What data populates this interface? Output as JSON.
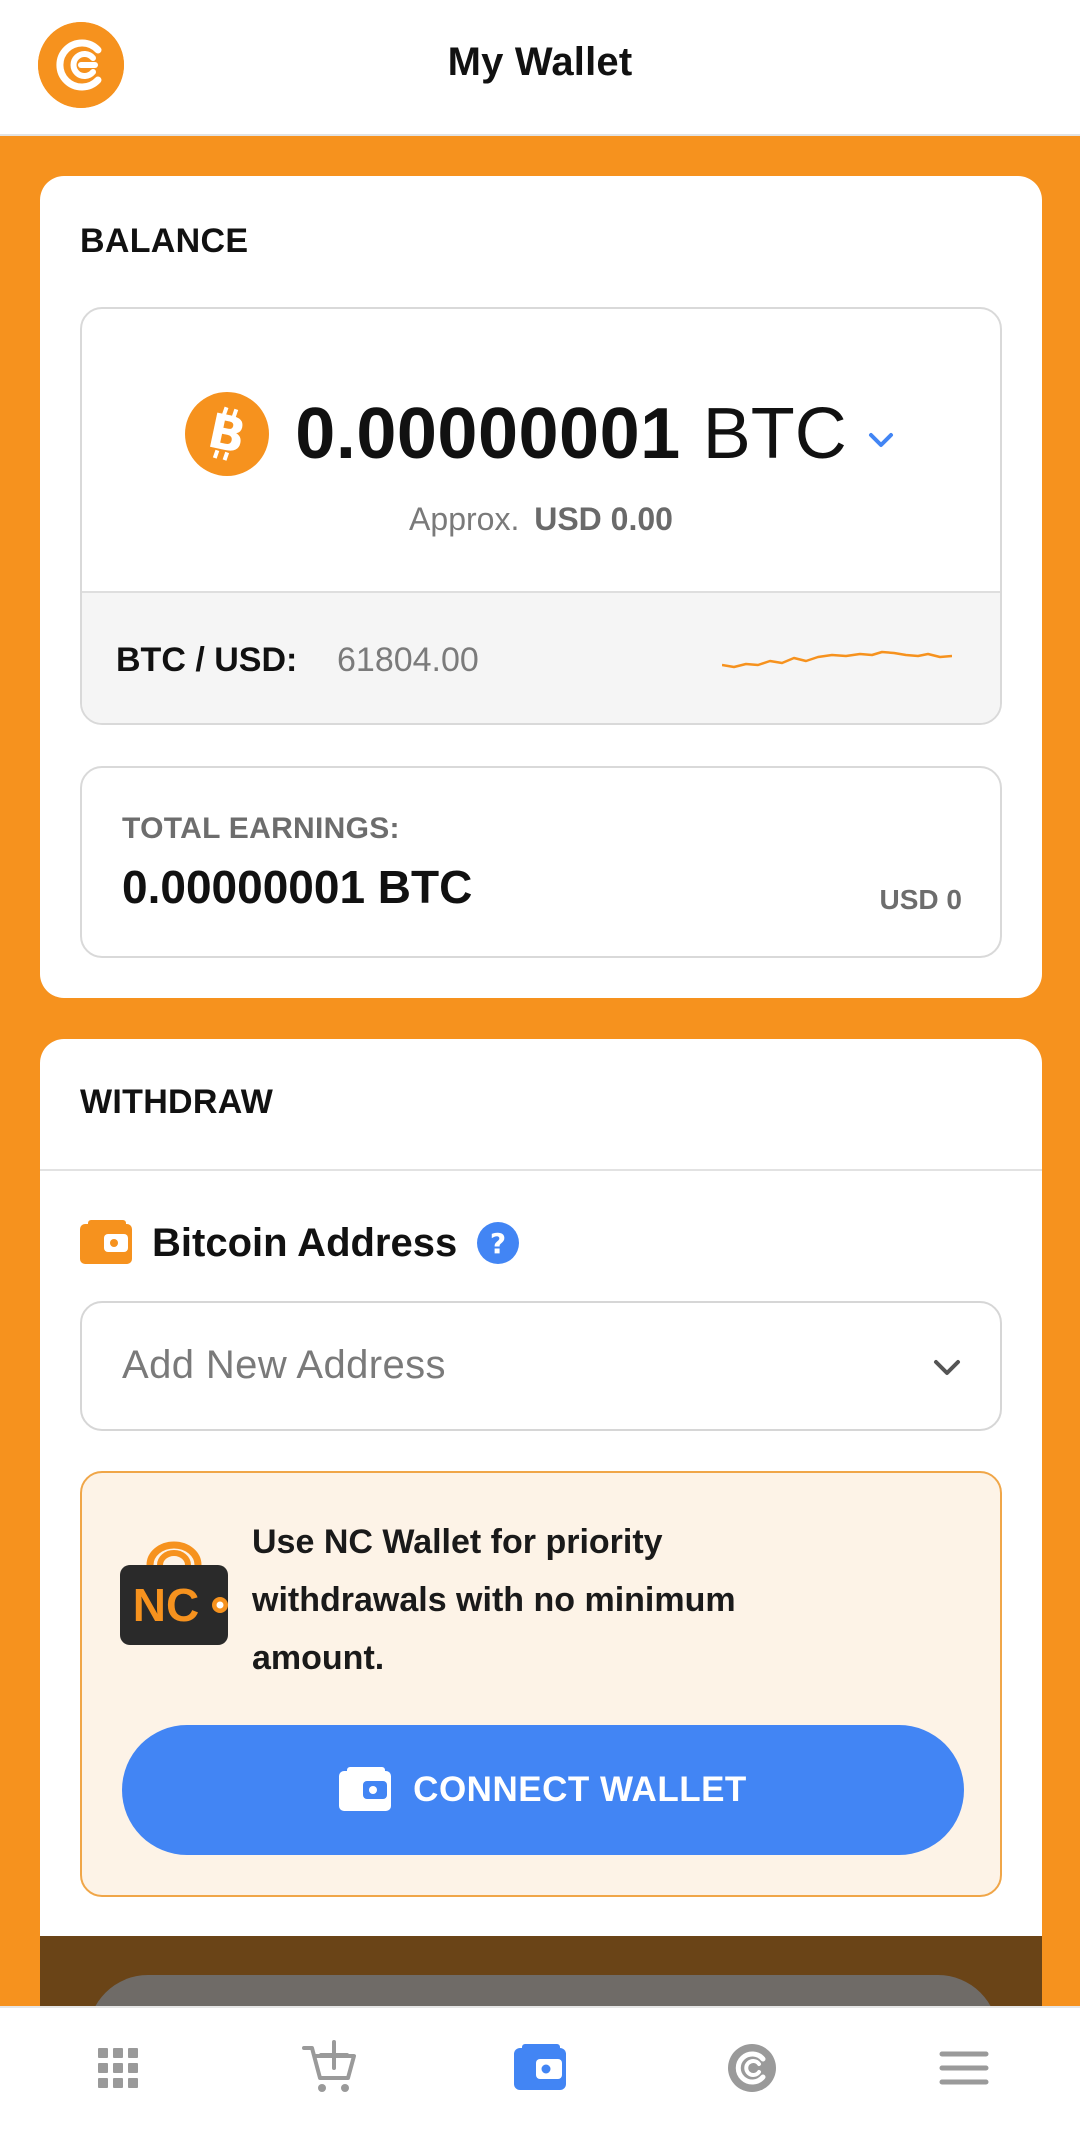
{
  "header": {
    "title": "My Wallet",
    "logo_icon": "coin-logo-icon"
  },
  "balance": {
    "section_label": "BALANCE",
    "amount": "0.00000001",
    "unit": "BTC",
    "approx_prefix": "Approx.",
    "approx_value": "USD 0.00",
    "rate_label": "BTC / USD:",
    "rate_value": "61804.00",
    "sparkline_color": "#f6921e"
  },
  "earnings": {
    "label": "TOTAL EARNINGS:",
    "amount": "0.00000001 BTC",
    "usd": "USD 0"
  },
  "withdraw": {
    "section_label": "WITHDRAW",
    "address_title": "Bitcoin Address",
    "address_placeholder": "Add New Address",
    "promo_text": "Use NC Wallet for priority withdrawals with no minimum amount.",
    "nc_logo_text": "NC",
    "connect_label": "CONNECT WALLET"
  },
  "bottom_nav": [
    {
      "name": "grid-icon",
      "active": false
    },
    {
      "name": "cart-add-icon",
      "active": false
    },
    {
      "name": "wallet-icon",
      "active": true
    },
    {
      "name": "coin-icon",
      "active": false
    },
    {
      "name": "menu-icon",
      "active": false
    }
  ],
  "colors": {
    "accent": "#f6921e",
    "primary_blue": "#4285f4",
    "nav_inactive": "#9a9a9a",
    "promo_bg": "#fdf3e7"
  }
}
